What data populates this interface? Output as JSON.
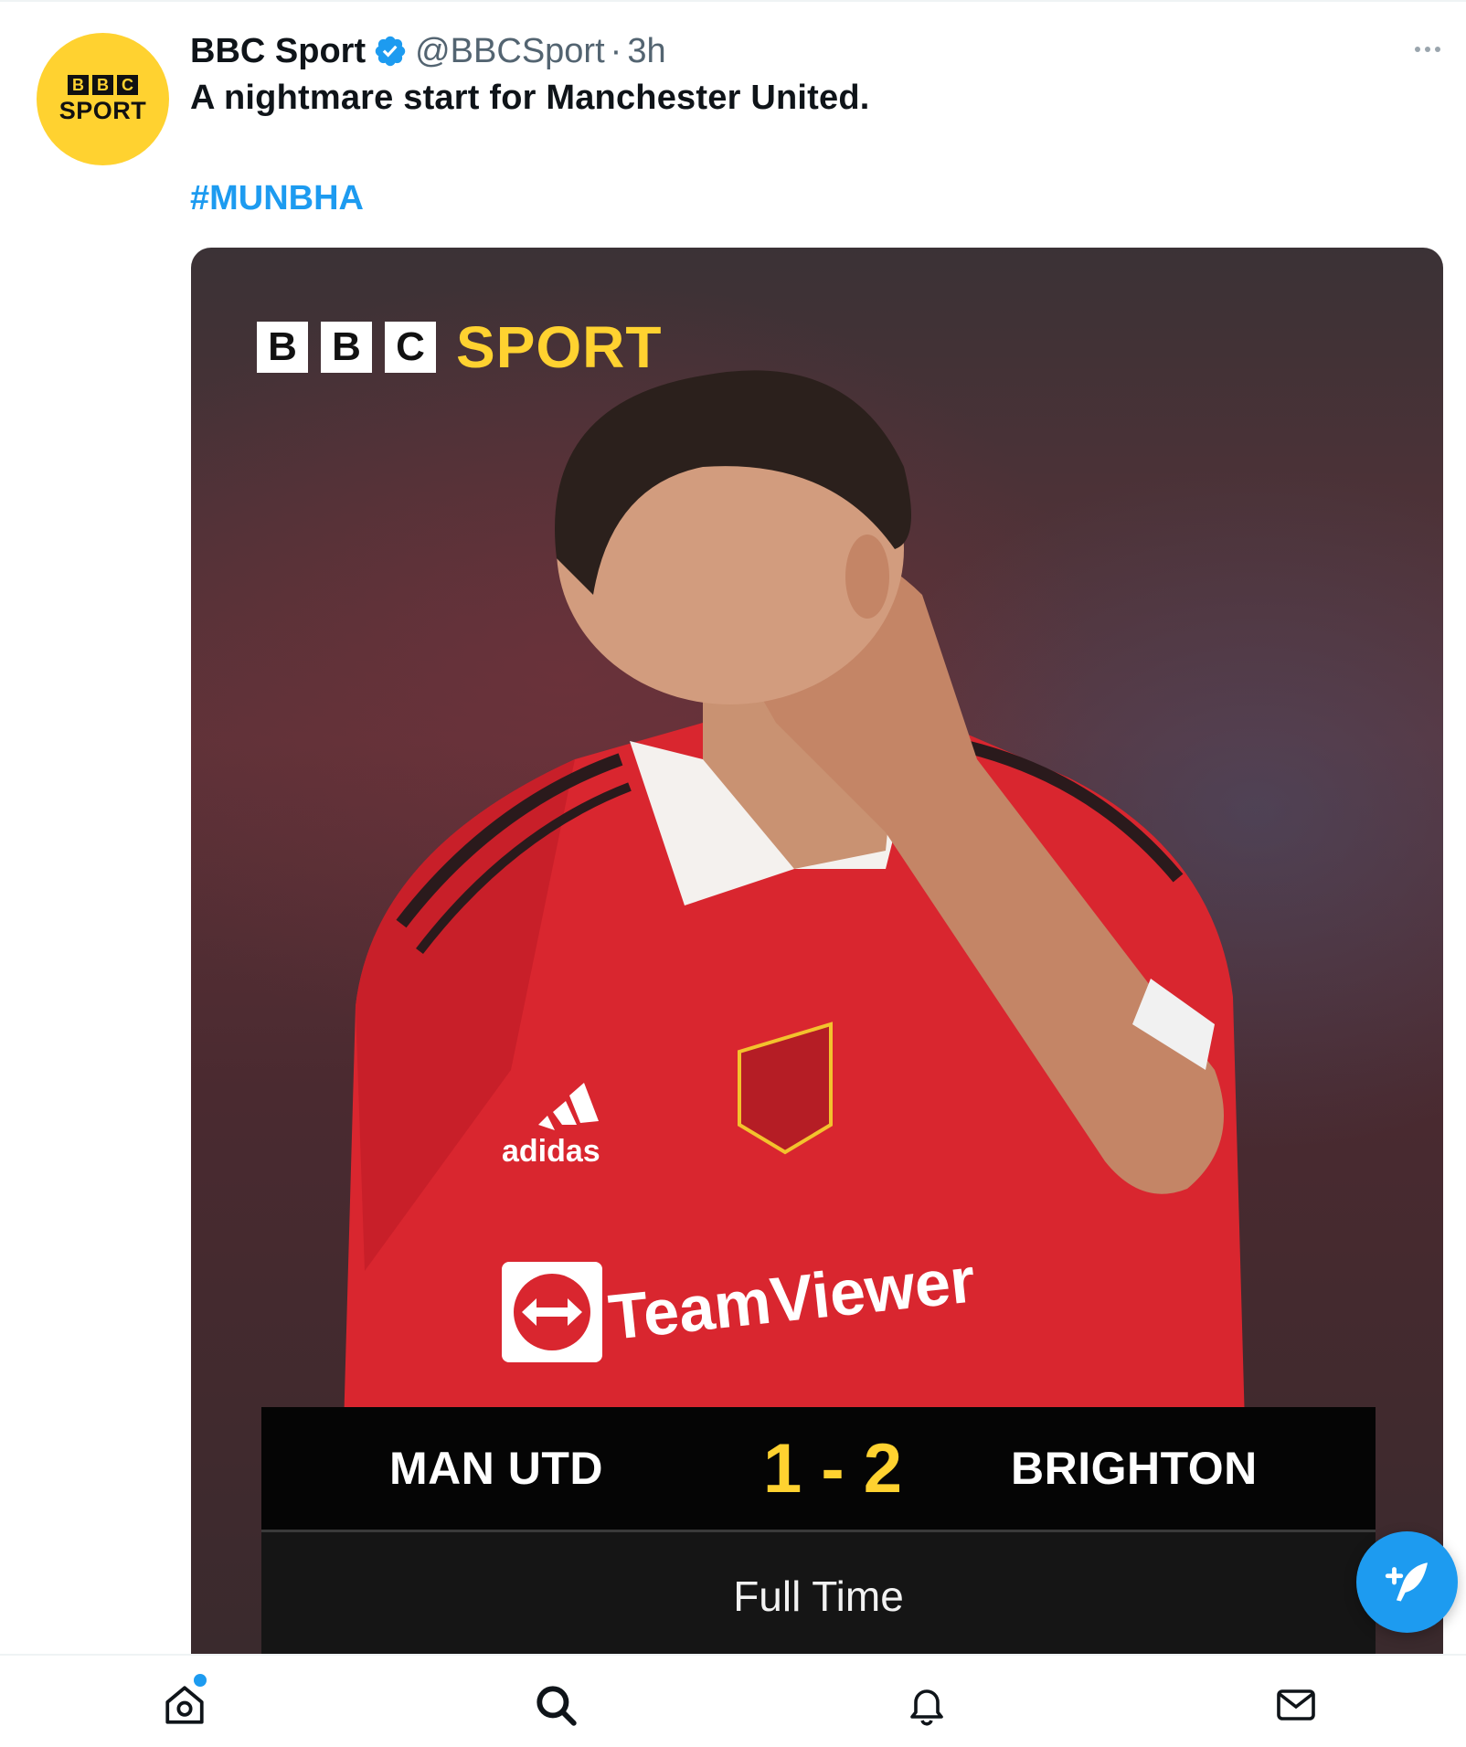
{
  "tweet": {
    "author_name": "BBC Sport",
    "handle": "@BBCSport",
    "separator": "·",
    "time": "3h",
    "text": "A nightmare start for Manchester United.",
    "hashtag": "#MUNBHA",
    "verified": true
  },
  "avatar": {
    "blocks": [
      "B",
      "B",
      "C"
    ],
    "word": "SPORT"
  },
  "media": {
    "brand_blocks": [
      "B",
      "B",
      "C"
    ],
    "brand_word": "SPORT",
    "shirt_sponsor": "TeamViewer",
    "kit_maker": "adidas",
    "scoreboard": {
      "home_team": "MAN UTD",
      "score": "1 - 2",
      "away_team": "BRIGHTON",
      "status": "Full Time"
    }
  },
  "colors": {
    "brand_yellow": "#ffd230",
    "link_blue": "#1d9bf0",
    "jersey_red": "#d9262f"
  },
  "icons": {
    "more": "more-horizontal-icon",
    "compose": "compose-feather-icon",
    "home": "home-icon",
    "search": "search-icon",
    "notifications": "bell-icon",
    "messages": "mail-icon"
  }
}
